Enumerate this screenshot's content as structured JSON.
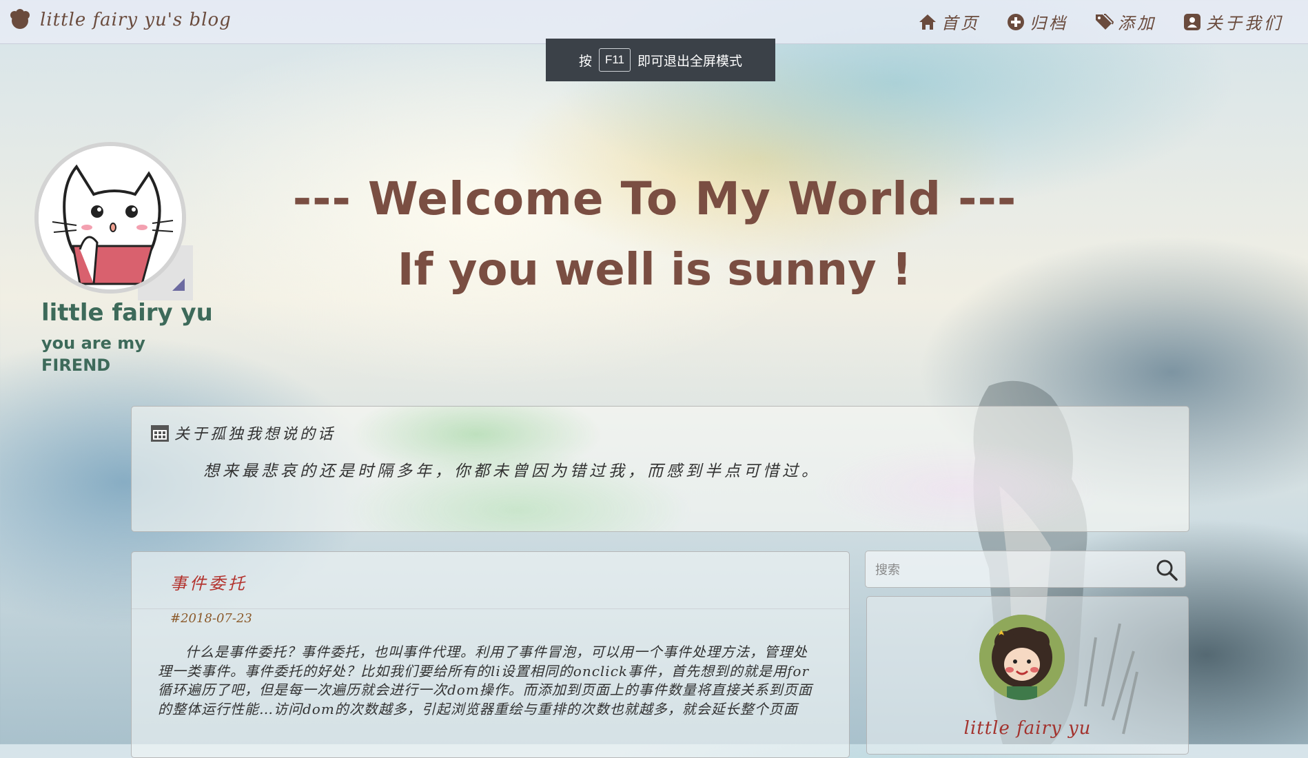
{
  "header": {
    "brand": "little fairy yu's blog",
    "nav": [
      {
        "label": "首页",
        "icon": "home-icon"
      },
      {
        "label": "归档",
        "icon": "plus-circle-icon"
      },
      {
        "label": "添加",
        "icon": "tags-icon"
      },
      {
        "label": "关于我们",
        "icon": "user-card-icon"
      }
    ]
  },
  "toast": {
    "prefix": "按",
    "key": "F11",
    "suffix": "即可退出全屏模式"
  },
  "profile": {
    "name": "little fairy yu",
    "motto": "you are my FIREND"
  },
  "hero": {
    "line1": "--- Welcome To My World ---",
    "line2": "If you well is sunny !"
  },
  "about": {
    "title": "关于孤独我想说的话",
    "text": "想来最悲哀的还是时隔多年，你都未曾因为错过我，而感到半点可惜过。"
  },
  "post": {
    "title": "事件委托",
    "date": "#2018-07-23",
    "body": "什么是事件委托？事件委托，也叫事件代理。利用了事件冒泡，可以用一个事件处理方法，管理处理一类事件。事件委托的好处？比如我们要给所有的li设置相同的onclick事件，首先想到的就是用for循环遍历了吧，但是每一次遍历就会进行一次dom操作。而添加到页面上的事件数量将直接关系到页面的整体运行性能…访问dom的次数越多，引起浏览器重绘与重排的次数也就越多，就会延长整个页面"
  },
  "sidebar": {
    "search_placeholder": "搜索",
    "card_name": "little fairy yu"
  },
  "colors": {
    "brown": "#7a4e42",
    "green": "#3d6a5a",
    "red": "#b3322d",
    "toast_bg": "#3b4148"
  }
}
